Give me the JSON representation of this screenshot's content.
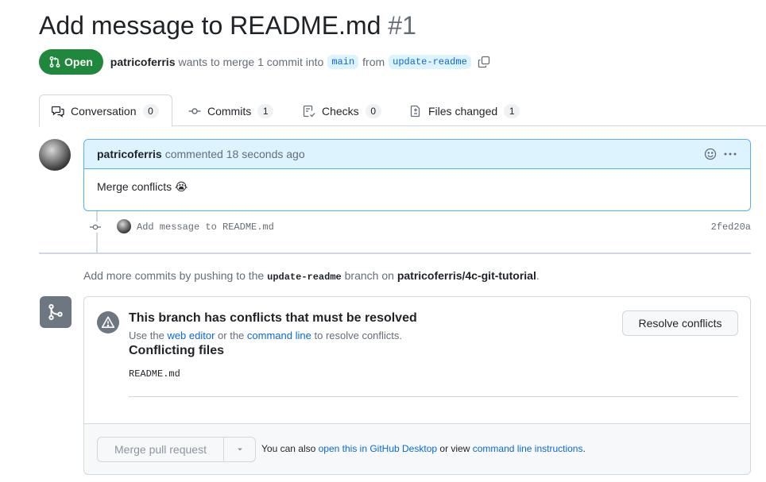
{
  "pr": {
    "title": "Add message to README.md",
    "number": "#1",
    "state": "Open",
    "author": "patricoferris",
    "merge_text_1": "wants to merge 1 commit into",
    "base_branch": "main",
    "merge_text_2": "from",
    "head_branch": "update-readme"
  },
  "tabs": [
    {
      "label": "Conversation",
      "count": "0",
      "icon": "comment-discussion-icon"
    },
    {
      "label": "Commits",
      "count": "1",
      "icon": "git-commit-icon"
    },
    {
      "label": "Checks",
      "count": "0",
      "icon": "checklist-icon"
    },
    {
      "label": "Files changed",
      "count": "1",
      "icon": "file-diff-icon"
    }
  ],
  "comment": {
    "author": "patricoferris",
    "action": "commented",
    "time": "18 seconds ago",
    "body": "Merge conflicts 😭"
  },
  "commit": {
    "message": "Add message to README.md",
    "sha": "2fed20a"
  },
  "push_hint": {
    "prefix": "Add more commits by pushing to the",
    "branch": "update-readme",
    "middle": "branch on",
    "repo": "patricoferris/4c-git-tutorial",
    "suffix": "."
  },
  "merge": {
    "conflict_title": "This branch has conflicts that must be resolved",
    "sub_prefix": "Use the",
    "web_editor": "web editor",
    "sub_mid": "or the",
    "command_line": "command line",
    "sub_suffix": "to resolve conflicts.",
    "resolve_button": "Resolve conflicts",
    "files_title": "Conflicting files",
    "files": [
      "README.md"
    ],
    "merge_button": "Merge pull request",
    "footer_prefix": "You can also",
    "footer_link1": "open this in GitHub Desktop",
    "footer_mid": "or view",
    "footer_link2": "command line instructions",
    "footer_suffix": "."
  },
  "colors": {
    "open_green": "#1f883d",
    "link_blue": "#0969da",
    "header_blue": "#ddf4ff",
    "border": "#d0d7de"
  }
}
